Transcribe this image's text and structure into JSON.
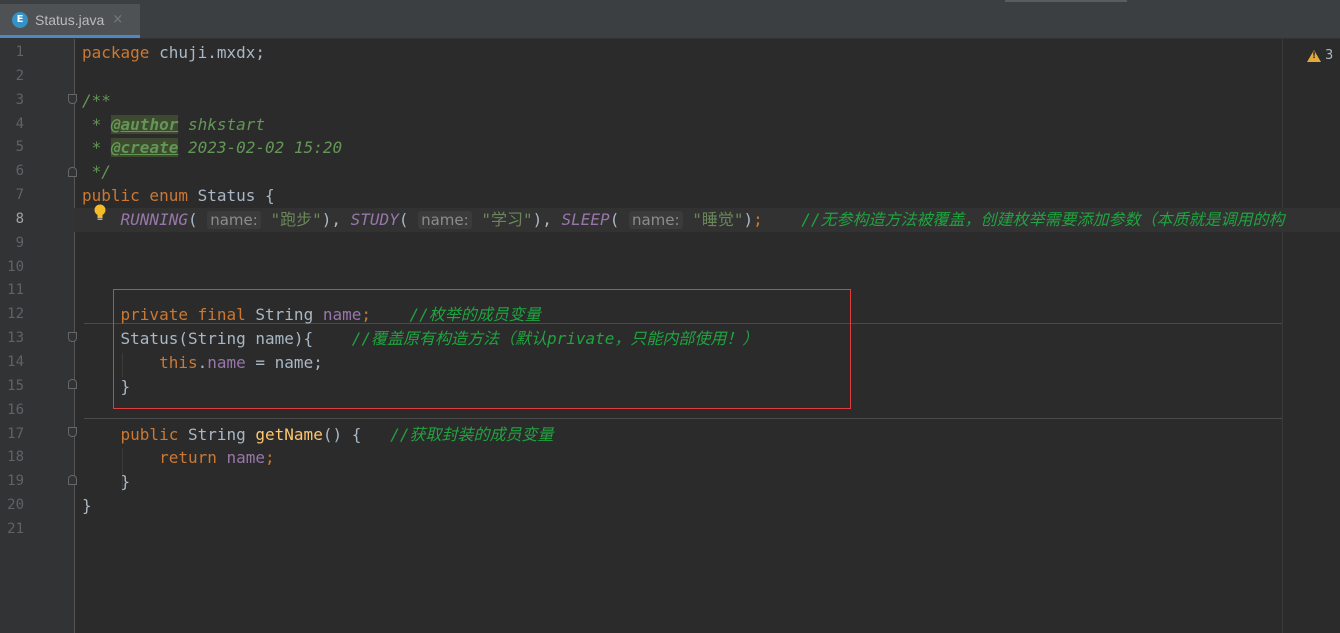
{
  "tab": {
    "icon_letter": "E",
    "title": "Status.java",
    "close": "×"
  },
  "warnings": {
    "count": "3"
  },
  "line_numbers": [
    "1",
    "2",
    "3",
    "4",
    "5",
    "6",
    "7",
    "8",
    "9",
    "10",
    "11",
    "12",
    "13",
    "14",
    "15",
    "16",
    "17",
    "18",
    "19",
    "20",
    "21"
  ],
  "code": {
    "l1_kw": "package",
    "l1_rest": " chuji.mxdx;",
    "l3": "/**",
    "l4_pre": " * ",
    "l4_tag": "@author",
    "l4_rest": " shkstart",
    "l5_pre": " * ",
    "l5_tag": "@create",
    "l5_rest": " 2023-02-02 15:20",
    "l6": " */",
    "l7_kw": "public enum",
    "l7_rest": " Status {",
    "l8_e1": "RUNNING",
    "l8_h1": "name:",
    "l8_s1": "\"跑步\"",
    "l8_e2": "STUDY",
    "l8_h2": "name:",
    "l8_s2": "\"学习\"",
    "l8_e3": "SLEEP",
    "l8_h3": "name:",
    "l8_s3": "\"睡觉\"",
    "l8_comment": "//无参构造方法被覆盖，创建枚举需要添加参数（本质就是调用的构",
    "l12_kw": "private final",
    "l12_type": " String ",
    "l12_field": "name",
    "l12_semi": ";",
    "l12_comment": "//枚举的成员变量",
    "l13_code": "Status(String name){",
    "l13_comment": "//覆盖原有构造方法（默认private，只能内部使用！）",
    "l14_kw": "this",
    "l14_dot": ".",
    "l14_field": "name",
    "l14_rest": " = name;",
    "l15": "}",
    "l17_kw": "public",
    "l17_type": " String ",
    "l17_method": "getName",
    "l17_rest": "() {",
    "l17_comment": "//获取封装的成员变量",
    "l18_kw": "return",
    "l18_field": "name",
    "l18_semi": ";",
    "l19": "}",
    "l20": "}"
  },
  "colors": {
    "keyword": "#cc7832",
    "comment": "#1fa43f",
    "field": "#9876aa",
    "highlight_box": "#e03e3e"
  }
}
